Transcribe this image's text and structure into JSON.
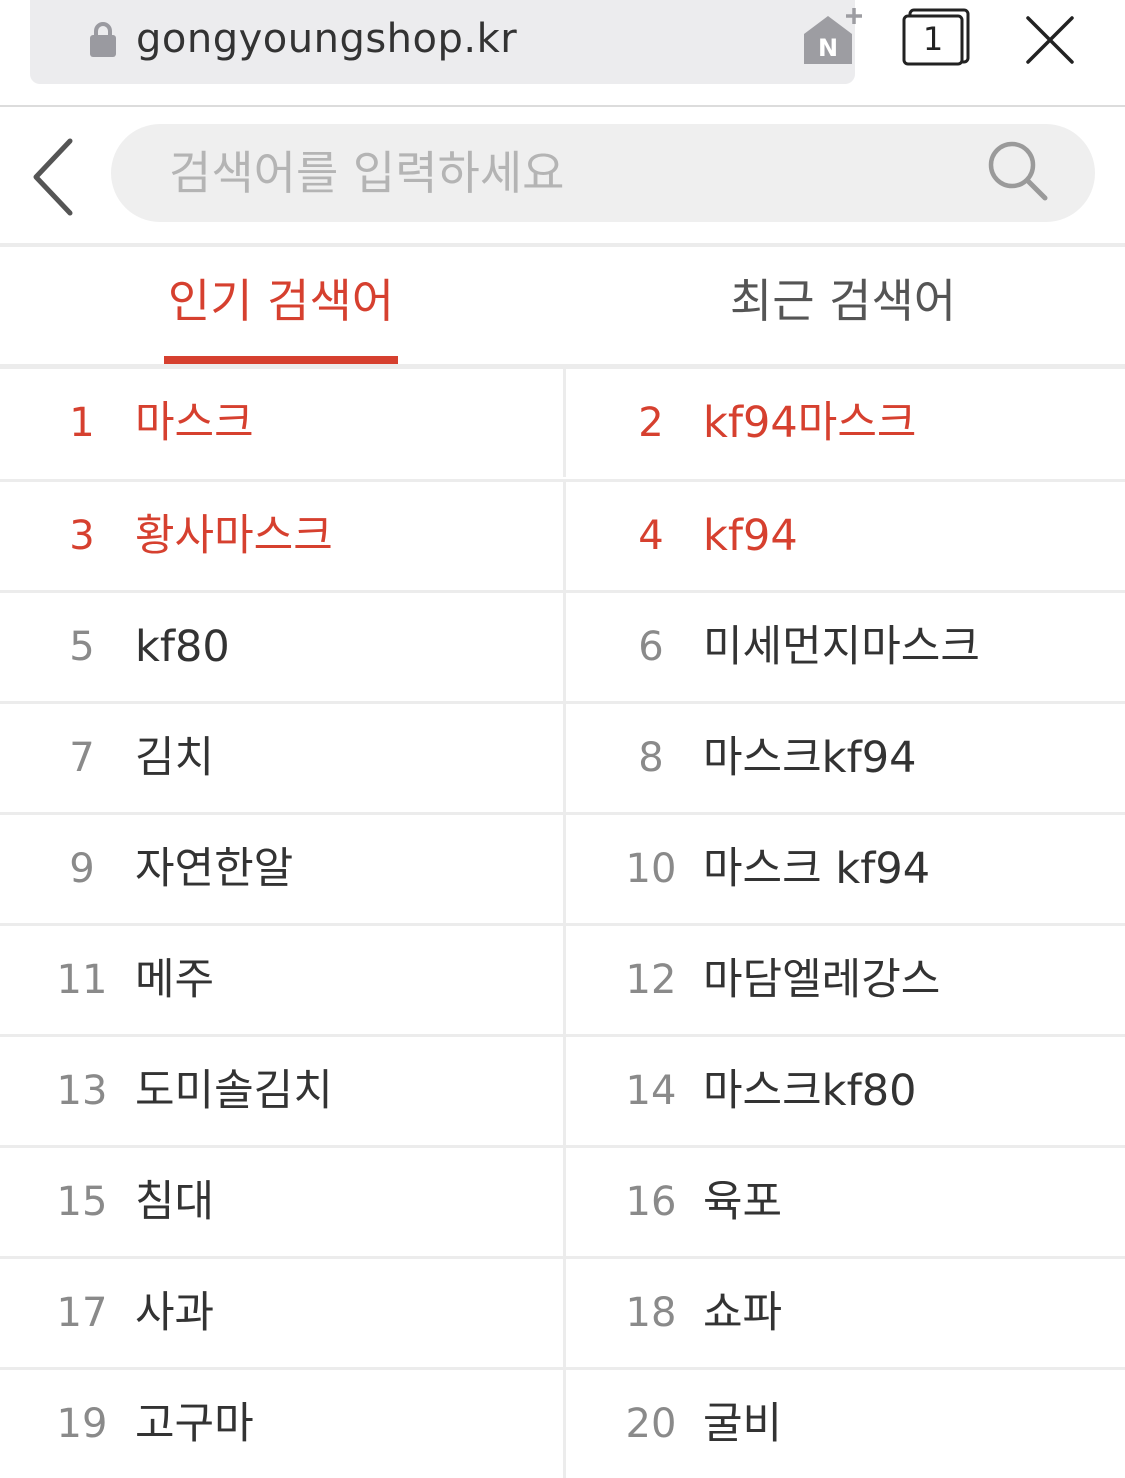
{
  "browser": {
    "url": "gongyoungshop.kr",
    "tab_count": "1",
    "icons": [
      "lock-icon",
      "naver-add-icon",
      "tabs-icon",
      "close-icon"
    ]
  },
  "search": {
    "placeholder": "검색어를 입력하세요",
    "value": "",
    "icons": [
      "back-arrow-icon",
      "search-icon"
    ]
  },
  "tabs": [
    {
      "label": "인기 검색어",
      "active": true
    },
    {
      "label": "최근 검색어",
      "active": false
    }
  ],
  "rankings": [
    {
      "rank": "1",
      "term": "마스크",
      "highlight": true
    },
    {
      "rank": "2",
      "term": "kf94마스크",
      "highlight": true
    },
    {
      "rank": "3",
      "term": "황사마스크",
      "highlight": true
    },
    {
      "rank": "4",
      "term": "kf94",
      "highlight": true
    },
    {
      "rank": "5",
      "term": "kf80",
      "highlight": false
    },
    {
      "rank": "6",
      "term": "미세먼지마스크",
      "highlight": false
    },
    {
      "rank": "7",
      "term": "김치",
      "highlight": false
    },
    {
      "rank": "8",
      "term": "마스크kf94",
      "highlight": false
    },
    {
      "rank": "9",
      "term": "자연한알",
      "highlight": false
    },
    {
      "rank": "10",
      "term": "마스크 kf94",
      "highlight": false
    },
    {
      "rank": "11",
      "term": "메주",
      "highlight": false
    },
    {
      "rank": "12",
      "term": "마담엘레강스",
      "highlight": false
    },
    {
      "rank": "13",
      "term": "도미솔김치",
      "highlight": false
    },
    {
      "rank": "14",
      "term": "마스크kf80",
      "highlight": false
    },
    {
      "rank": "15",
      "term": "침대",
      "highlight": false
    },
    {
      "rank": "16",
      "term": "육포",
      "highlight": false
    },
    {
      "rank": "17",
      "term": "사과",
      "highlight": false
    },
    {
      "rank": "18",
      "term": "쇼파",
      "highlight": false
    },
    {
      "rank": "19",
      "term": "고구마",
      "highlight": false
    },
    {
      "rank": "20",
      "term": "굴비",
      "highlight": false
    }
  ],
  "colors": {
    "accent": "#d6402f",
    "text": "#333333",
    "rank_number": "#8a8a8a",
    "divider": "#ececec",
    "search_box": "#efefef"
  }
}
